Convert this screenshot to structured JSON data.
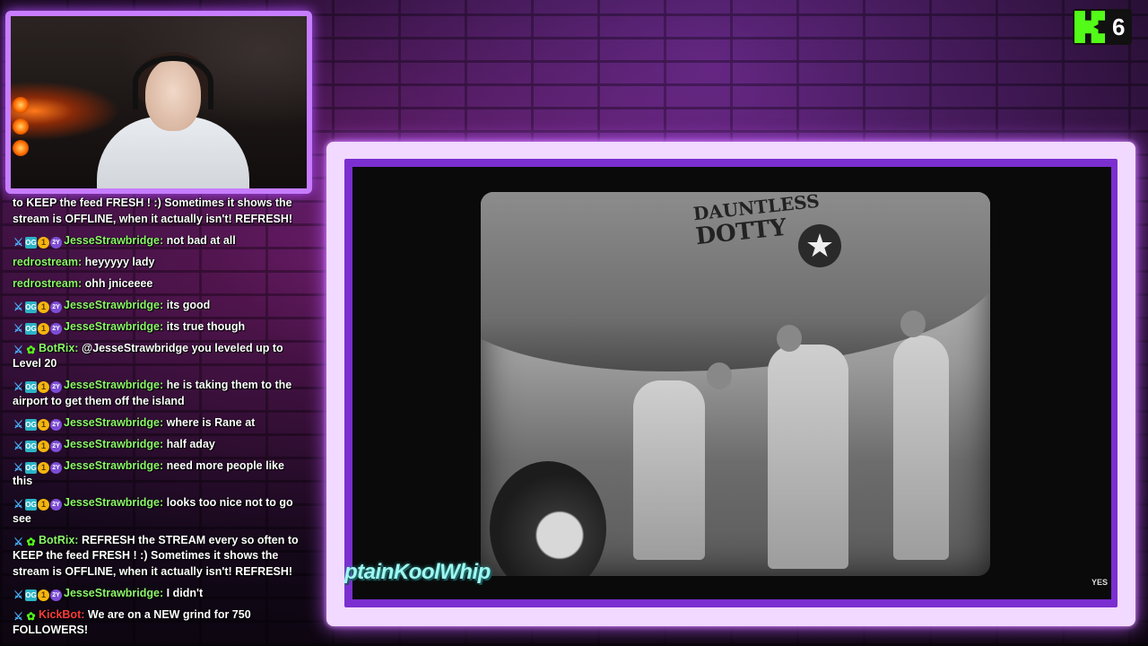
{
  "kick": {
    "count": "6"
  },
  "overlay": {
    "name_text": "ptainKoolWhip",
    "network_logo": "YES"
  },
  "footage": {
    "plane_nose_art_line1": "DAUNTLESS",
    "plane_nose_art_line2": "DOTTY",
    "insignia": "★"
  },
  "badges": {
    "og": "OG",
    "coin": "1",
    "sub": "2Y",
    "sword": "⚔",
    "bot": "✿"
  },
  "colors": {
    "accent": "#c77dff",
    "kick_green": "#53fc18",
    "user_green": "#7CFC6A",
    "kickbot_red": "#ff3b3b"
  },
  "chat": [
    {
      "user": "",
      "color": "#ffffff",
      "badges": [],
      "text": "to KEEP the feed FRESH ! :) Sometimes it shows the stream is OFFLINE, when it actually isn't! REFRESH!"
    },
    {
      "user": "JesseStrawbridge:",
      "color": "#8df66a",
      "badges": [
        "sword",
        "og",
        "coin",
        "sub"
      ],
      "text": "not bad at all"
    },
    {
      "user": "redrostream:",
      "color": "#8df66a",
      "badges": [],
      "text": "heyyyyy lady"
    },
    {
      "user": "redrostream:",
      "color": "#8df66a",
      "badges": [],
      "text": "ohh jniceeee"
    },
    {
      "user": "JesseStrawbridge:",
      "color": "#8df66a",
      "badges": [
        "sword",
        "og",
        "coin",
        "sub"
      ],
      "text": "its good"
    },
    {
      "user": "JesseStrawbridge:",
      "color": "#8df66a",
      "badges": [
        "sword",
        "og",
        "coin",
        "sub"
      ],
      "text": "its true though"
    },
    {
      "user": "BotRix:",
      "color": "#8df66a",
      "badges": [
        "sword",
        "bot"
      ],
      "text": "@JesseStrawbridge you leveled up to Level 20"
    },
    {
      "user": "JesseStrawbridge:",
      "color": "#8df66a",
      "badges": [
        "sword",
        "og",
        "coin",
        "sub"
      ],
      "text": "he is taking them to the airport to get them off the island"
    },
    {
      "user": "JesseStrawbridge:",
      "color": "#8df66a",
      "badges": [
        "sword",
        "og",
        "coin",
        "sub"
      ],
      "text": "where is Rane at"
    },
    {
      "user": "JesseStrawbridge:",
      "color": "#8df66a",
      "badges": [
        "sword",
        "og",
        "coin",
        "sub"
      ],
      "text": "half aday"
    },
    {
      "user": "JesseStrawbridge:",
      "color": "#8df66a",
      "badges": [
        "sword",
        "og",
        "coin",
        "sub"
      ],
      "text": "need more people like this"
    },
    {
      "user": "JesseStrawbridge:",
      "color": "#8df66a",
      "badges": [
        "sword",
        "og",
        "coin",
        "sub"
      ],
      "text": "looks too nice not to go see"
    },
    {
      "user": "BotRix:",
      "color": "#8df66a",
      "badges": [
        "sword",
        "bot"
      ],
      "text": "REFRESH the STREAM every so often to KEEP the feed FRESH ! :) Sometimes it shows the stream is OFFLINE, when it actually isn't! REFRESH!"
    },
    {
      "user": "JesseStrawbridge:",
      "color": "#8df66a",
      "badges": [
        "sword",
        "og",
        "coin",
        "sub"
      ],
      "text": "I didn't"
    },
    {
      "user": "KickBot:",
      "color": "#ff3b3b",
      "badges": [
        "sword",
        "bot"
      ],
      "text": "We are on a NEW grind for 750 FOLLOWERS!"
    }
  ]
}
